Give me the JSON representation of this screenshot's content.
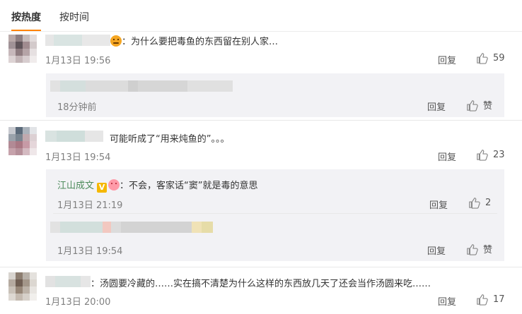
{
  "tabs": [
    {
      "label": "按热度",
      "active": true
    },
    {
      "label": "按时间",
      "active": false
    }
  ],
  "comments": [
    {
      "text": "：为什么要把毒鱼的东西留在别人家…",
      "time": "1月13日 19:56",
      "reply_label": "回复",
      "likes": "59"
    },
    {
      "text": "可能听成了“用来炖鱼的”。。。",
      "time": "1月13日 19:54",
      "reply_label": "回复",
      "likes": "23"
    },
    {
      "text": "：汤圆要冷藏的……实在搞不清楚为什么这样的东西放几天了还会当作汤圆来吃……",
      "time": "1月13日 20:00",
      "reply_label": "回复",
      "likes": "17"
    }
  ],
  "replies": [
    {
      "time": "18分钟前",
      "reply_label": "回复",
      "like_label": "赞"
    },
    {
      "username": "江山成文",
      "verified_badge": "V",
      "text": "：不会，客家话“窦”就是毒的意思",
      "time": "1月13日 21:19",
      "reply_label": "回复",
      "likes": "2"
    },
    {
      "time": "1月13日 19:54",
      "reply_label": "回复",
      "like_label": "赞"
    }
  ],
  "colors": {
    "accent": "#ff8200",
    "username": "#ee7e14",
    "reply_bg": "#f2f2f5",
    "time": "#808080"
  },
  "icons": {
    "like": "thumbs-up-icon",
    "verified": "verified-v-icon"
  }
}
